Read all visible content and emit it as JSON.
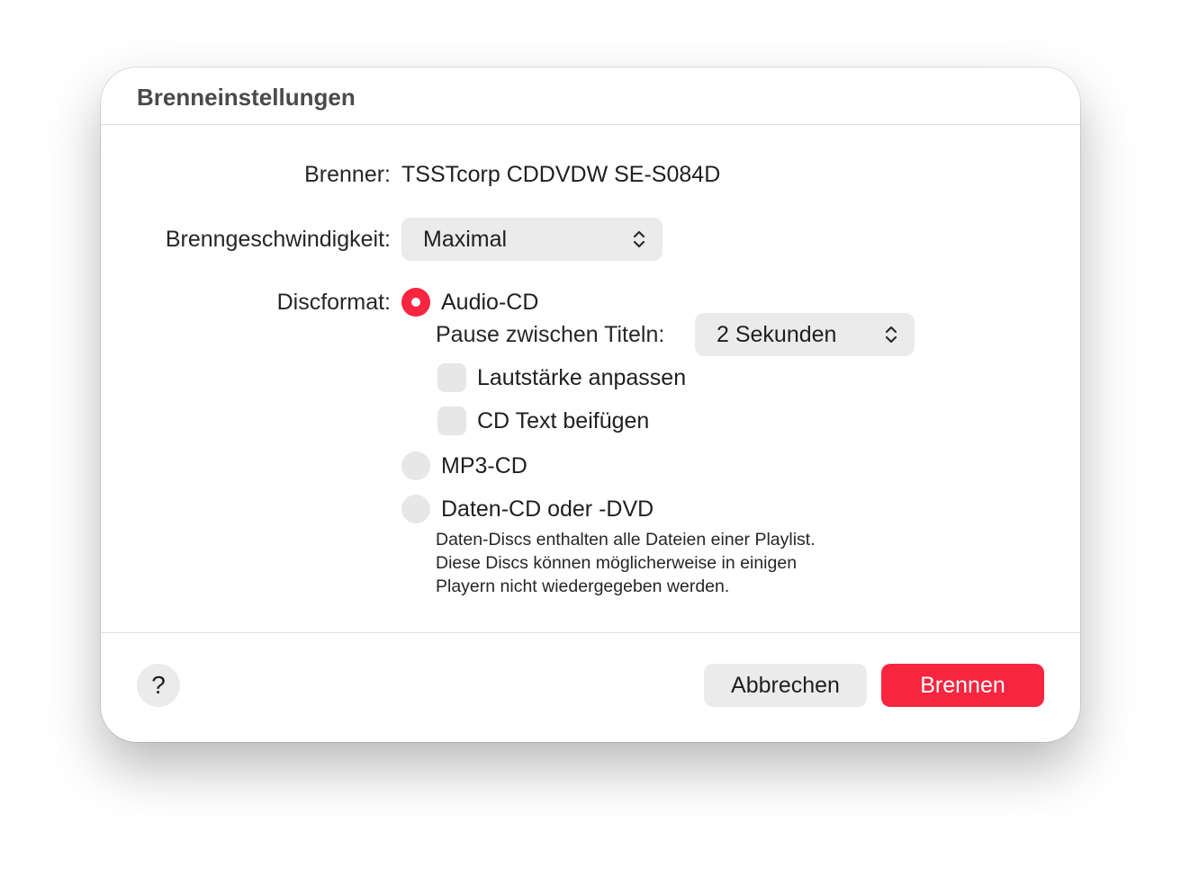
{
  "dialog": {
    "title": "Brenneinstellungen"
  },
  "burner": {
    "label": "Brenner:",
    "value": "TSSTcorp CDDVDW SE-S084D"
  },
  "speed": {
    "label": "Brenngeschwindigkeit:",
    "selected": "Maximal"
  },
  "disc_format": {
    "label": "Discformat:",
    "options": [
      {
        "label": "Audio-CD",
        "selected": true
      },
      {
        "label": "MP3-CD",
        "selected": false
      },
      {
        "label": "Daten-CD oder -DVD",
        "selected": false
      }
    ],
    "audio_cd": {
      "pause_label": "Pause zwischen Titeln:",
      "pause_selected": "2 Sekunden",
      "volume_label": "Lautstärke anpassen",
      "volume_checked": false,
      "cdtext_label": "CD Text beifügen",
      "cdtext_checked": false
    },
    "data_note": [
      "Daten-Discs enthalten alle Dateien einer Playlist.",
      "Diese Discs können möglicherweise in einigen",
      "Playern nicht wiedergegeben werden."
    ]
  },
  "footer": {
    "help_label": "?",
    "cancel_label": "Abbrechen",
    "burn_label": "Brennen"
  },
  "colors": {
    "accent": "#f7253f",
    "control_bg": "#ebebeb"
  }
}
